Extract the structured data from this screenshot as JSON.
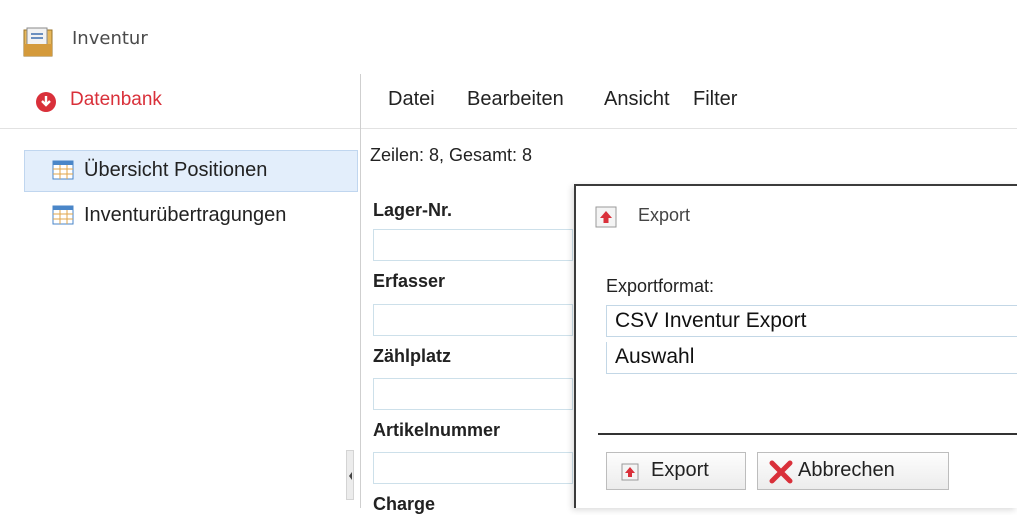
{
  "window": {
    "title": "Inventur"
  },
  "sidebar": {
    "database_label": "Datenbank",
    "items": [
      {
        "label": "Übersicht Positionen",
        "selected": true
      },
      {
        "label": "Inventurübertragungen",
        "selected": false
      }
    ]
  },
  "menubar": {
    "items": [
      "Datei",
      "Bearbeiten",
      "Ansicht",
      "Filter"
    ]
  },
  "status": {
    "rows_info": "Zeilen: 8, Gesamt: 8"
  },
  "filter_form": {
    "fields": [
      {
        "label": "Lager-Nr.",
        "value": ""
      },
      {
        "label": "Erfasser",
        "value": ""
      },
      {
        "label": "Zählplatz",
        "value": ""
      },
      {
        "label": "Artikelnummer",
        "value": ""
      },
      {
        "label": "Charge",
        "value": ""
      }
    ]
  },
  "dialog": {
    "title": "Export",
    "format_label": "Exportformat:",
    "format_value": "CSV Inventur Export",
    "selection_value": "Auswahl",
    "export_button": "Export",
    "cancel_button": "Abbrechen"
  },
  "colors": {
    "accent_red": "#d9303a",
    "selection_bg": "#e3eefb"
  }
}
